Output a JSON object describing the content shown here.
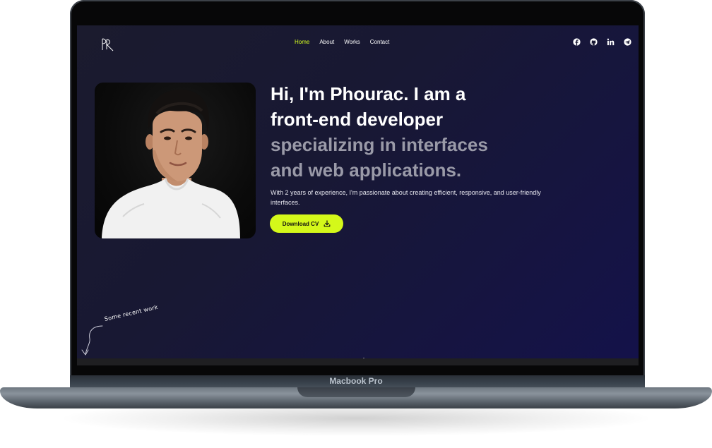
{
  "device": {
    "model_label": "Macbook Pro"
  },
  "site": {
    "logo_text": "PR",
    "nav": [
      {
        "label": "Home",
        "active": true
      },
      {
        "label": "About",
        "active": false
      },
      {
        "label": "Works",
        "active": false
      },
      {
        "label": "Contact",
        "active": false
      }
    ],
    "socials": [
      "facebook-icon",
      "github-icon",
      "linkedin-icon",
      "telegram-icon"
    ]
  },
  "hero": {
    "headline_line1": "Hi, I'm Phourac. I am a",
    "headline_line2": "front-end developer",
    "headline_line3": "specializing in interfaces",
    "headline_line4": "and web applications.",
    "description": "With 2 years of experience, I'm passionate about creating efficient, responsive, and user-friendly interfaces.",
    "cta_label": "Download CV",
    "recent_work_label": "Some recent work"
  },
  "colors": {
    "accent": "#d4f81a",
    "background": "#181833",
    "headline_secondary": "#9a9aa8"
  }
}
